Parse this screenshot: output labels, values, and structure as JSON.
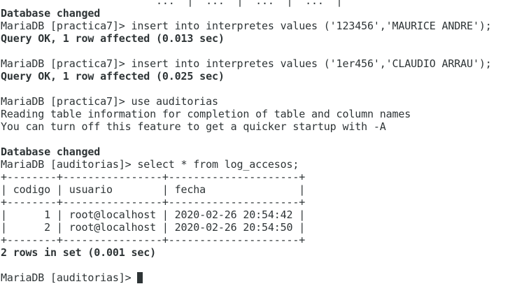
{
  "terminal": {
    "lines": [
      {
        "text": "                         ...  |  ...  |  ...  |  ...  |",
        "style": "clipped"
      },
      {
        "text": "Database changed",
        "style": "bold"
      },
      {
        "text": "MariaDB [practica7]> insert into interpretes values ('123456','MAURICE ANDRE');",
        "style": "normal"
      },
      {
        "text": "Query OK, 1 row affected (0.013 sec)",
        "style": "bold"
      },
      {
        "text": "",
        "style": "normal"
      },
      {
        "text": "MariaDB [practica7]> insert into interpretes values ('1er456','CLAUDIO ARRAU');",
        "style": "normal"
      },
      {
        "text": "Query OK, 1 row affected (0.025 sec)",
        "style": "bold"
      },
      {
        "text": "",
        "style": "normal"
      },
      {
        "text": "MariaDB [practica7]> use auditorias",
        "style": "normal"
      },
      {
        "text": "Reading table information for completion of table and column names",
        "style": "normal"
      },
      {
        "text": "You can turn off this feature to get a quicker startup with -A",
        "style": "normal"
      },
      {
        "text": "",
        "style": "normal"
      },
      {
        "text": "Database changed",
        "style": "bold"
      },
      {
        "text": "MariaDB [auditorias]> select * from log_accesos;",
        "style": "normal"
      },
      {
        "text": "+--------+----------------+---------------------+",
        "style": "normal"
      },
      {
        "text": "| codigo | usuario        | fecha               |",
        "style": "normal"
      },
      {
        "text": "+--------+----------------+---------------------+",
        "style": "normal"
      },
      {
        "text": "|      1 | root@localhost | 2020-02-26 20:54:42 |",
        "style": "normal"
      },
      {
        "text": "|      2 | root@localhost | 2020-02-26 20:54:50 |",
        "style": "normal"
      },
      {
        "text": "+--------+----------------+---------------------+",
        "style": "normal"
      },
      {
        "text": "2 rows in set (0.001 sec)",
        "style": "bold"
      },
      {
        "text": "",
        "style": "normal"
      }
    ],
    "prompt": "MariaDB [auditorias]> ",
    "colors": {
      "background": "#ffffff",
      "foreground": "#2e3436"
    }
  }
}
